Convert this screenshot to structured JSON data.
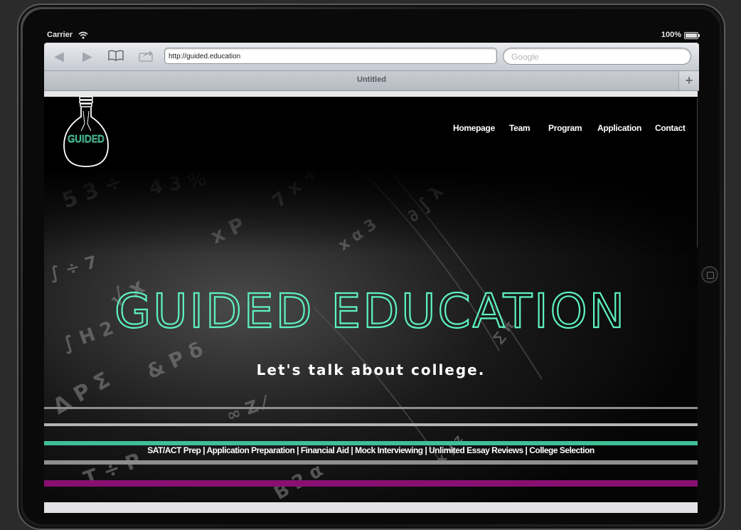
{
  "statusbar": {
    "carrier": "Carrier",
    "battery": "100%"
  },
  "browser": {
    "url": "http://guided.education",
    "search_placeholder": "Google",
    "tab_title": "Untitled",
    "new_tab": "+"
  },
  "site": {
    "logo_text": "GUIDED",
    "nav": [
      "Homepage",
      "Team",
      "Program",
      "Application",
      "Contact"
    ],
    "hero_title": "GUIDED EDUCATION",
    "tagline": "Let's talk about college.",
    "services": "SAT/ACT Prep | Application Preparation | Financial Aid | Mock Interviewing | Unlimited Essay Reviews | College Selection"
  },
  "colors": {
    "accent": "#5ef2c1",
    "stripe_teal": "#3fbf97",
    "stripe_magenta": "#8a0f73",
    "stripe_gray": "#8e8e8e",
    "stripe_light": "#b4b4b4"
  },
  "icons": [
    "wifi-icon",
    "battery-icon",
    "back-icon",
    "forward-icon",
    "bookmarks-icon",
    "share-icon",
    "lightbulb-icon"
  ]
}
